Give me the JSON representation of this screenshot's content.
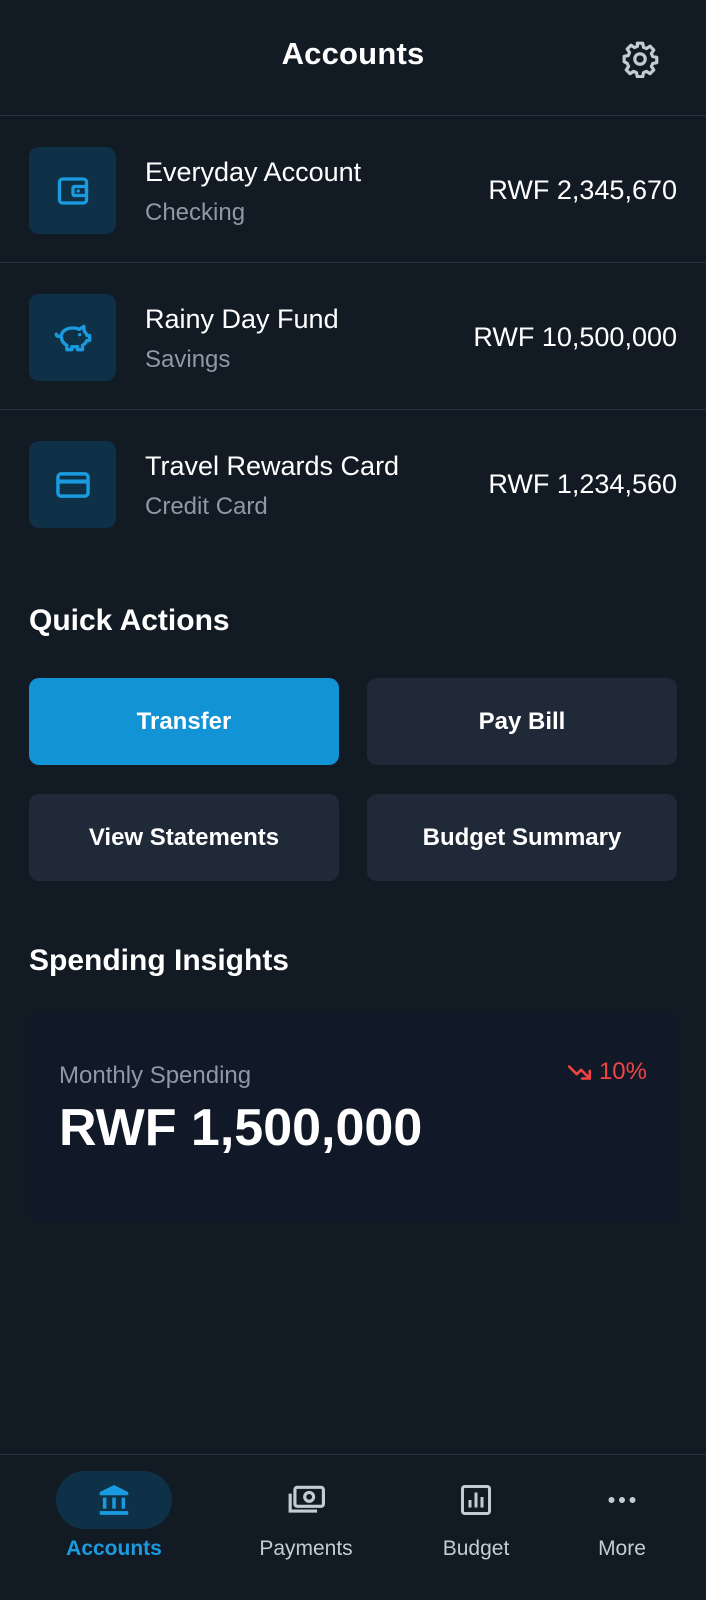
{
  "header": {
    "title": "Accounts",
    "settings_icon": "gear-icon"
  },
  "accounts": [
    {
      "name": "Everyday Account",
      "type": "Checking",
      "balance": "RWF 2,345,670",
      "icon": "wallet-icon"
    },
    {
      "name": "Rainy Day Fund",
      "type": "Savings",
      "balance": "RWF 10,500,000",
      "icon": "piggy-bank-icon"
    },
    {
      "name": "Travel Rewards Card",
      "type": "Credit Card",
      "balance": "RWF 1,234,560",
      "icon": "credit-card-icon"
    }
  ],
  "quick_actions": {
    "title": "Quick Actions",
    "buttons": [
      "Transfer",
      "Pay Bill",
      "View Statements",
      "Budget Summary"
    ]
  },
  "insights": {
    "title": "Spending Insights",
    "label": "Monthly Spending",
    "amount": "RWF 1,500,000",
    "trend": "10%",
    "trend_direction": "down"
  },
  "nav": {
    "items": [
      {
        "label": "Accounts",
        "icon": "bank-icon",
        "active": true
      },
      {
        "label": "Payments",
        "icon": "cash-icon",
        "active": false
      },
      {
        "label": "Budget",
        "icon": "bar-chart-icon",
        "active": false
      },
      {
        "label": "More",
        "icon": "more-dots-icon",
        "active": false
      }
    ]
  },
  "colors": {
    "background": "#121b24",
    "accent": "#1193d6",
    "icon_tile": "#0f3148",
    "secondary_button": "#1f2937",
    "trend_down": "#ef4444",
    "muted_text": "#8e99a5"
  }
}
